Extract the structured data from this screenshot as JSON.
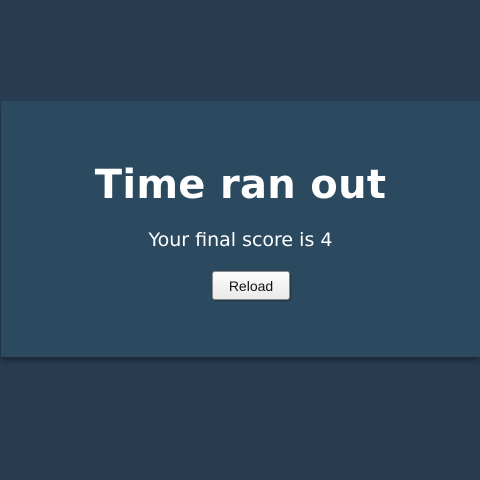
{
  "dialog": {
    "title": "Time ran out",
    "score_text": "Your final score is 4",
    "reload_label": "Reload"
  },
  "colors": {
    "page_background": "#283d52",
    "panel_background": "#2c4a5f",
    "text": "#ffffff"
  }
}
